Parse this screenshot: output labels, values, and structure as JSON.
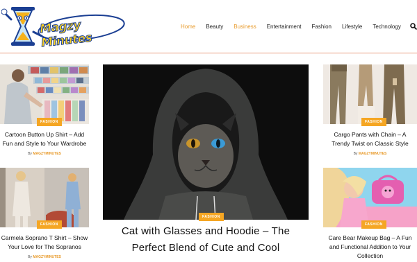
{
  "site": {
    "logo_text": "Magzy Minutes"
  },
  "nav": {
    "items": [
      "Home",
      "Beauty",
      "Business",
      "Entertainment",
      "Fashion",
      "Lifestyle",
      "Technology"
    ]
  },
  "cards": {
    "left_top": {
      "category": "FASHION",
      "title_line1": "Cartoon Button Up Shirt – Add",
      "title_line2": "Fun and Style to Your Wardrobe",
      "by": "By",
      "author": "MAGZYMINUTES"
    },
    "left_bottom": {
      "category": "FASHION",
      "title_line1": "Carmela Soprano T Shirt – Show",
      "title_line2": "Your Love for The Sopranos",
      "by": "By",
      "author": "MAGZYMINUTES"
    },
    "center": {
      "category": "FASHION",
      "title_line1": "Cat with Glasses and Hoodie – The",
      "title_line2": "Perfect Blend of Cute and Cool"
    },
    "right_top": {
      "category": "FASHION",
      "title_line1": "Cargo Pants with Chain – A",
      "title_line2": "Trendy Twist on Classic Style",
      "by": "By",
      "author": "MAGZYMINUTES"
    },
    "right_bottom": {
      "category": "FASHION",
      "title_line1": "Care Bear Makeup Bag – A Fun",
      "title_line2": "and Functional Addition to Your",
      "title_line3": "Collection"
    }
  },
  "colors": {
    "accent": "#f5a623",
    "divider": "#e89a7c",
    "logo_yellow": "#ffd21f",
    "logo_blue": "#1b3f93"
  }
}
